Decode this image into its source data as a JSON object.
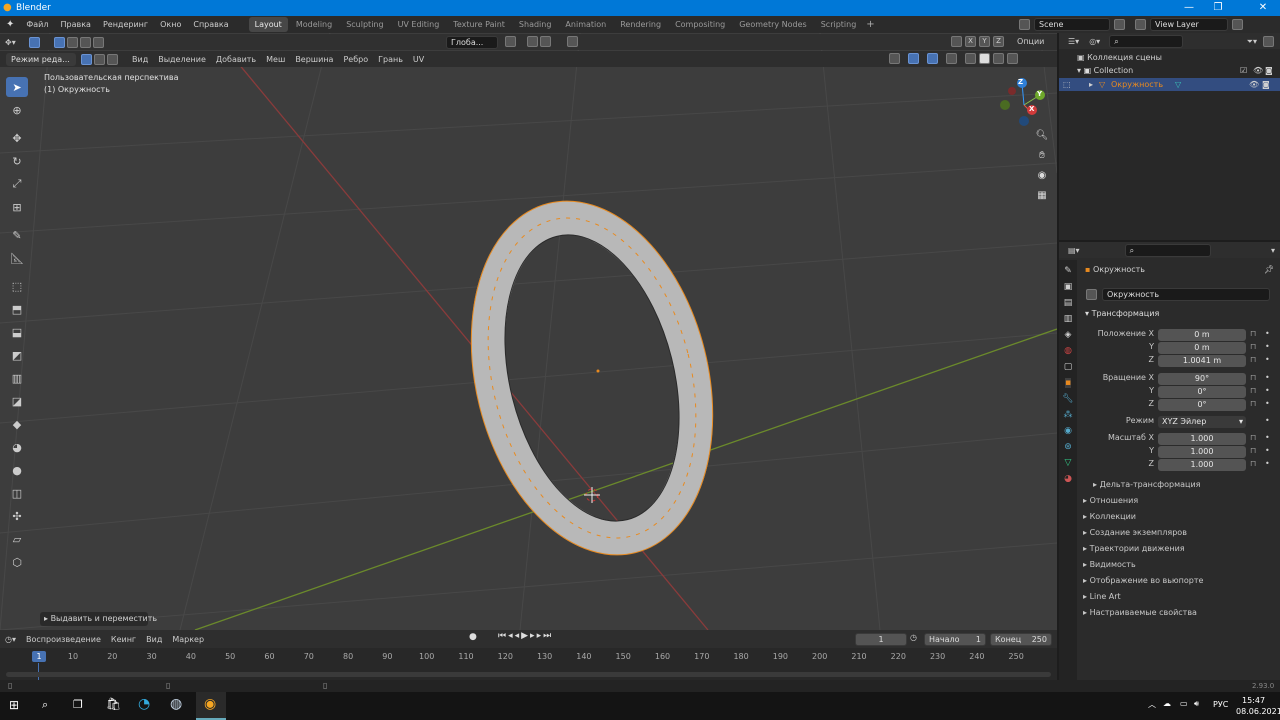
{
  "window": {
    "title": "Blender"
  },
  "menu": [
    "Файл",
    "Правка",
    "Рендеринг",
    "Окно",
    "Справка"
  ],
  "workspaces": [
    "Layout",
    "Modeling",
    "Sculpting",
    "UV Editing",
    "Texture Paint",
    "Shading",
    "Animation",
    "Rendering",
    "Compositing",
    "Geometry Nodes",
    "Scripting"
  ],
  "active_workspace": "Layout",
  "scene": {
    "name": "Scene",
    "view_layer": "View Layer"
  },
  "viewport": {
    "mode": "Режим реда...",
    "menus": [
      "Вид",
      "Выделение",
      "Добавить",
      "Меш",
      "Вершина",
      "Ребро",
      "Грань",
      "UV"
    ],
    "orientation": "Глоба...",
    "options": "Опции",
    "overlay_line1": "Пользовательская перспектива",
    "overlay_line2": "(1) Окружность",
    "last_op": "Выдавить и переместить",
    "axes": [
      "X",
      "Y",
      "Z"
    ]
  },
  "timeline": {
    "playback": "Воспроизведение",
    "keying": "Кеинг",
    "view": "Вид",
    "marker": "Маркер",
    "current_frame": "1",
    "start_label": "Начало",
    "start": "1",
    "end_label": "Конец",
    "end": "250",
    "ticks": [
      "10",
      "20",
      "30",
      "40",
      "50",
      "60",
      "70",
      "80",
      "90",
      "100",
      "110",
      "120",
      "130",
      "140",
      "150",
      "160",
      "170",
      "180",
      "190",
      "200",
      "210",
      "220",
      "230",
      "240",
      "250"
    ],
    "cursor": "1"
  },
  "outliner": {
    "root": "Коллекция сцены",
    "collection": "Collection",
    "object": "Окружность"
  },
  "properties": {
    "object_name": "Окружность",
    "object_field": "Окружность",
    "transform_title": "Трансформация",
    "location_label": "Положение X",
    "location": [
      "0 m",
      "0 m",
      "1.0041 m"
    ],
    "rotation_label": "Вращение X",
    "rotation": [
      "90°",
      "0°",
      "0°"
    ],
    "mode_label": "Режим",
    "mode": "XYZ Эйлер",
    "scale_label": "Масштаб X",
    "scale": [
      "1.000",
      "1.000",
      "1.000"
    ],
    "delta": "Дельта-трансформация",
    "sections": [
      "Отношения",
      "Коллекции",
      "Создание экземпляров",
      "Траектории движения",
      "Видимость",
      "Отображение во вьюпорте",
      "Line Art",
      "Настраиваемые свойства"
    ]
  },
  "status": {
    "version": "2.93.0"
  },
  "taskbar": {
    "lang": "РУС",
    "time": "15:47",
    "date": "08.06.2021"
  },
  "colors": {
    "accent": "#4772b3",
    "selected": "#e88a1f",
    "viewport_bg": "#3d3d3d"
  }
}
